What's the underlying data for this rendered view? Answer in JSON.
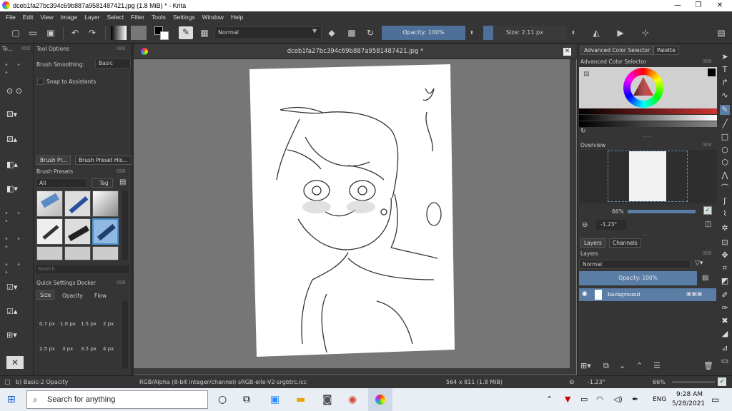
{
  "window": {
    "title": "dceb1fa27bc394c69b887a9581487421.jpg (1.8 MiB)  * - Krita",
    "minimize": "—",
    "maximize": "❐",
    "close": "✕"
  },
  "menu": [
    "File",
    "Edit",
    "View",
    "Image",
    "Layer",
    "Select",
    "Filter",
    "Tools",
    "Settings",
    "Window",
    "Help"
  ],
  "toolbar": {
    "blend_mode": "Normal",
    "opacity": "Opacity: 100%",
    "size": "Size: 2.11 px"
  },
  "left_strip": {
    "label": "To...",
    "btns": "☒☒"
  },
  "tool_options": {
    "title": "Tool Options",
    "brush_smoothing_label": "Brush Smoothing:",
    "brush_smoothing_value": "Basic",
    "snap_label": "Snap to Assistants"
  },
  "brush_presets": {
    "tab1": "Brush Pr...",
    "tab2": "Brush Preset His...",
    "title": "Brush Presets",
    "filter": "All",
    "tag": "Tag",
    "search_placeholder": "Search"
  },
  "quick_settings": {
    "title": "Quick Settings Docker",
    "tabs": [
      "Size",
      "Opacity",
      "Flow"
    ],
    "sizes_row1": [
      "0.7 px",
      "1.0 px",
      "1.5 px",
      "2 px"
    ],
    "sizes_row2": [
      "2.5 px",
      "3 px",
      "3.5 px",
      "4 px"
    ]
  },
  "canvas": {
    "tab_title": "dceb1fa27bc394c69b887a9581487421.jpg *"
  },
  "right_panel": {
    "tab1": "Advanced Color Selector",
    "tab2": "Palette",
    "color_title": "Advanced Color Selector",
    "overview_title": "Overview",
    "zoom": "66%",
    "rotation": "-1.23°",
    "layers_tab": "Layers",
    "channels_tab": "Channels",
    "layers_title": "Layers",
    "layer_blend": "Normal",
    "layer_opacity": "Opacity:  100%",
    "layer_name": "background"
  },
  "status": {
    "brush": "b) Basic-2 Opacity",
    "colorspace": "RGB/Alpha (8-bit integer/channel)  sRGB-elle-V2-srgbtrc.icc",
    "dims": "564 x 811 (1.8 MiB)",
    "rotation": "-1.23°",
    "zoom": "66%"
  },
  "taskbar": {
    "search_placeholder": "Search for anything",
    "lang": "ENG",
    "time": "9:28 AM",
    "date": "5/28/2021"
  },
  "colors": {
    "accent": "#4e6f98",
    "panel": "#353535",
    "canvas_bg": "#767676"
  }
}
